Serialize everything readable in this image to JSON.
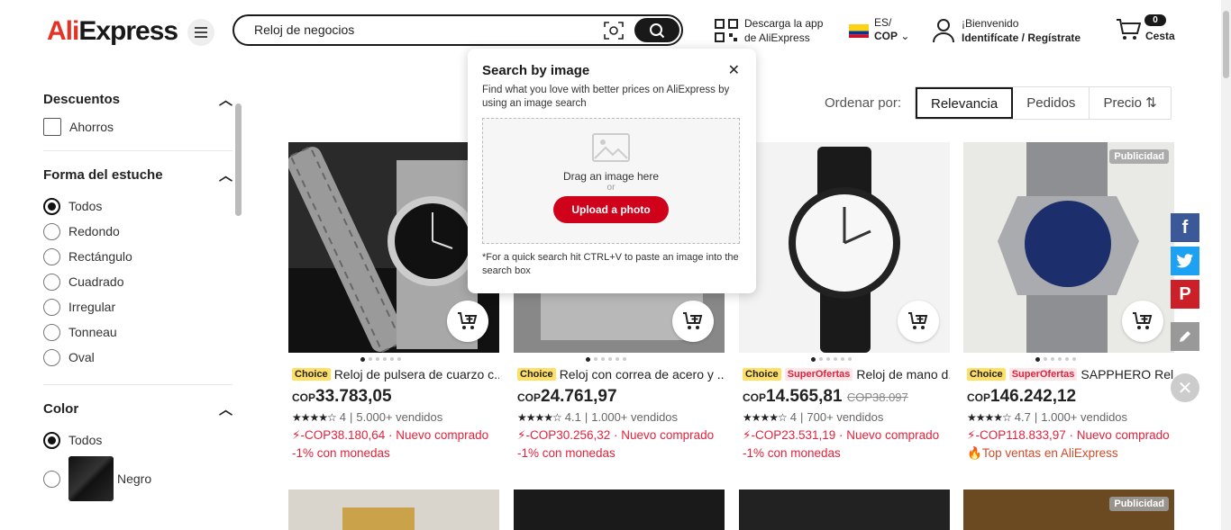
{
  "header": {
    "logo_ali": "Ali",
    "logo_express": "Express",
    "search_value": "Reloj de negocios",
    "download_line1": "Descarga la app",
    "download_line2": "de AliExpress",
    "lang": "ES/",
    "currency": "COP",
    "welcome": "¡Bienvenido",
    "signin": "Identifícate / Regístrate",
    "cart_count": "0",
    "cart_label": "Cesta"
  },
  "sidebar": {
    "discounts_title": "Descuentos",
    "discount_option": "Ahorros",
    "case_title": "Forma del estuche",
    "case_options": [
      "Todos",
      "Redondo",
      "Rectángulo",
      "Cuadrado",
      "Irregular",
      "Tonneau",
      "Oval"
    ],
    "color_title": "Color",
    "color_options": [
      "Todos",
      "Negro"
    ]
  },
  "sort": {
    "label": "Ordenar por:",
    "options": [
      "Relevancia",
      "Pedidos",
      "Precio"
    ]
  },
  "popup": {
    "title": "Search by image",
    "desc": "Find what you love with better prices on AliExpress by using an image search",
    "drag": "Drag an image here",
    "or": "or",
    "upload": "Upload a photo",
    "hint": "*For a quick search hit CTRL+V to paste an image into the search box"
  },
  "products": [
    {
      "title": "Reloj de pulsera de cuarzo c...",
      "tag_choice": "Choice",
      "currency": "COP",
      "price": "33.783,05",
      "stars": "★★★★☆",
      "rating": "4",
      "sold": "5.000+ vendidos",
      "promo": "-COP38.180,64 · Nuevo comprado",
      "coins": "-1% con monedas"
    },
    {
      "title": "Reloj con correa de acero y ...",
      "tag_choice": "Choice",
      "currency": "COP",
      "price": "24.761,97",
      "stars": "★★★★☆",
      "rating": "4.1",
      "sold": "1.000+ vendidos",
      "promo": "-COP30.256,32 · Nuevo comprado",
      "coins": "-1% con monedas"
    },
    {
      "title": "Reloj de mano d...",
      "tag_choice": "Choice",
      "tag_super": "SuperOfertas",
      "currency": "COP",
      "price": "14.565,81",
      "old_price": "COP38.097",
      "stars": "★★★★☆",
      "rating": "4",
      "sold": "700+ vendidos",
      "promo": "-COP23.531,19 · Nuevo comprado",
      "coins": "-1% con monedas"
    },
    {
      "title": "SAPPHERO Rel...",
      "tag_choice": "Choice",
      "tag_super": "SuperOfertas",
      "badge": "Publicidad",
      "currency": "COP",
      "price": "146.242,12",
      "stars": "★★★★☆",
      "rating": "4.7",
      "sold": "1.000+ vendidos",
      "promo": "-COP118.833,97 · Nuevo comprado",
      "coins": "Top ventas en AliExpress"
    }
  ],
  "row2_badge": "Publicidad",
  "colors": {
    "accent": "#e3223c",
    "dark": "#191919",
    "facebook": "#3b5998",
    "twitter": "#1da1f2",
    "pinterest": "#cb2027"
  }
}
